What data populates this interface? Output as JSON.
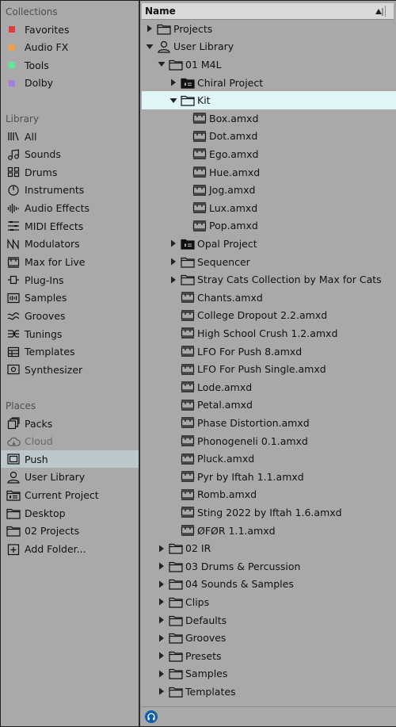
{
  "sidebar": {
    "collections_title": "Collections",
    "collections": [
      {
        "label": "Favorites",
        "color": "#e5393b"
      },
      {
        "label": "Audio FX",
        "color": "#f0a04b"
      },
      {
        "label": "Tools",
        "color": "#5de89a"
      },
      {
        "label": "Dolby",
        "color": "#a37fe0"
      }
    ],
    "library_title": "Library",
    "library": [
      {
        "label": "All",
        "icon": "all-icon"
      },
      {
        "label": "Sounds",
        "icon": "sounds-icon"
      },
      {
        "label": "Drums",
        "icon": "drums-icon"
      },
      {
        "label": "Instruments",
        "icon": "instruments-icon"
      },
      {
        "label": "Audio Effects",
        "icon": "audio-effects-icon"
      },
      {
        "label": "MIDI Effects",
        "icon": "midi-effects-icon"
      },
      {
        "label": "Modulators",
        "icon": "modulators-icon"
      },
      {
        "label": "Max for Live",
        "icon": "max-for-live-icon"
      },
      {
        "label": "Plug-Ins",
        "icon": "plug-ins-icon"
      },
      {
        "label": "Samples",
        "icon": "samples-icon"
      },
      {
        "label": "Grooves",
        "icon": "grooves-icon"
      },
      {
        "label": "Tunings",
        "icon": "tunings-icon"
      },
      {
        "label": "Templates",
        "icon": "templates-icon"
      },
      {
        "label": "Synthesizer",
        "icon": "synthesizer-icon"
      }
    ],
    "places_title": "Places",
    "places": [
      {
        "label": "Packs",
        "icon": "packs-icon"
      },
      {
        "label": "Cloud",
        "icon": "cloud-icon"
      },
      {
        "label": "Push",
        "icon": "push-icon"
      },
      {
        "label": "User Library",
        "icon": "user-icon"
      },
      {
        "label": "Current Project",
        "icon": "current-project-icon"
      },
      {
        "label": "Desktop",
        "icon": "folder-icon"
      },
      {
        "label": "02 Projects",
        "icon": "folder-icon"
      },
      {
        "label": "Add Folder...",
        "icon": "add-folder-icon"
      }
    ]
  },
  "browser": {
    "header": "Name",
    "rows": [
      {
        "label": "Projects",
        "icon": "folder-icon",
        "expand": "right",
        "indent": 0
      },
      {
        "label": "User Library",
        "icon": "user-icon",
        "expand": "down",
        "indent": 0
      },
      {
        "label": "01 M4L",
        "icon": "folder-icon",
        "expand": "down",
        "indent": 1
      },
      {
        "label": "Chiral Project",
        "icon": "project-folder-icon",
        "expand": "right",
        "indent": 2
      },
      {
        "label": "Kit",
        "icon": "folder-icon",
        "expand": "down",
        "indent": 2
      },
      {
        "label": "Box.amxd",
        "icon": "device-icon",
        "expand": "",
        "indent": 3
      },
      {
        "label": "Dot.amxd",
        "icon": "device-icon",
        "expand": "",
        "indent": 3
      },
      {
        "label": "Ego.amxd",
        "icon": "device-icon",
        "expand": "",
        "indent": 3
      },
      {
        "label": "Hue.amxd",
        "icon": "device-icon",
        "expand": "",
        "indent": 3
      },
      {
        "label": "Jog.amxd",
        "icon": "device-icon",
        "expand": "",
        "indent": 3
      },
      {
        "label": "Lux.amxd",
        "icon": "device-icon",
        "expand": "",
        "indent": 3
      },
      {
        "label": "Pop.amxd",
        "icon": "device-icon",
        "expand": "",
        "indent": 3
      },
      {
        "label": "Opal Project",
        "icon": "project-folder-icon",
        "expand": "right",
        "indent": 2
      },
      {
        "label": "Sequencer",
        "icon": "folder-icon",
        "expand": "right",
        "indent": 2
      },
      {
        "label": "Stray Cats Collection by Max for Cats",
        "icon": "folder-icon",
        "expand": "right",
        "indent": 2
      },
      {
        "label": "Chants.amxd",
        "icon": "device-icon",
        "expand": "",
        "indent": 2
      },
      {
        "label": "College Dropout 2.2.amxd",
        "icon": "device-icon",
        "expand": "",
        "indent": 2
      },
      {
        "label": "High School Crush 1.2.amxd",
        "icon": "device-icon",
        "expand": "",
        "indent": 2
      },
      {
        "label": "LFO For Push 8.amxd",
        "icon": "device-icon",
        "expand": "",
        "indent": 2
      },
      {
        "label": "LFO For Push Single.amxd",
        "icon": "device-icon",
        "expand": "",
        "indent": 2
      },
      {
        "label": "Lode.amxd",
        "icon": "device-icon",
        "expand": "",
        "indent": 2
      },
      {
        "label": "Petal.amxd",
        "icon": "device-icon",
        "expand": "",
        "indent": 2
      },
      {
        "label": "Phase Distortion.amxd",
        "icon": "device-icon",
        "expand": "",
        "indent": 2
      },
      {
        "label": "Phonogeneli 0.1.amxd",
        "icon": "device-icon",
        "expand": "",
        "indent": 2
      },
      {
        "label": "Pluck.amxd",
        "icon": "device-icon",
        "expand": "",
        "indent": 2
      },
      {
        "label": "Pyr by Iftah 1.1.amxd",
        "icon": "device-icon",
        "expand": "",
        "indent": 2
      },
      {
        "label": "Romb.amxd",
        "icon": "device-icon",
        "expand": "",
        "indent": 2
      },
      {
        "label": "Sting 2022 by Iftah 1.6.amxd",
        "icon": "device-icon",
        "expand": "",
        "indent": 2
      },
      {
        "label": "ØFØR 1.1.amxd",
        "icon": "device-icon",
        "expand": "",
        "indent": 2
      },
      {
        "label": "02 IR",
        "icon": "folder-icon",
        "expand": "right",
        "indent": 1
      },
      {
        "label": "03 Drums & Percussion",
        "icon": "folder-icon",
        "expand": "right",
        "indent": 1
      },
      {
        "label": "04 Sounds & Samples",
        "icon": "folder-icon",
        "expand": "right",
        "indent": 1
      },
      {
        "label": "Clips",
        "icon": "folder-icon",
        "expand": "right",
        "indent": 1
      },
      {
        "label": "Defaults",
        "icon": "folder-icon",
        "expand": "right",
        "indent": 1
      },
      {
        "label": "Grooves",
        "icon": "folder-icon",
        "expand": "right",
        "indent": 1
      },
      {
        "label": "Presets",
        "icon": "folder-icon",
        "expand": "right",
        "indent": 1
      },
      {
        "label": "Samples",
        "icon": "folder-icon",
        "expand": "right",
        "indent": 1
      },
      {
        "label": "Templates",
        "icon": "folder-icon",
        "expand": "right",
        "indent": 1
      }
    ]
  },
  "footer": {
    "icon": "headphones-icon"
  }
}
